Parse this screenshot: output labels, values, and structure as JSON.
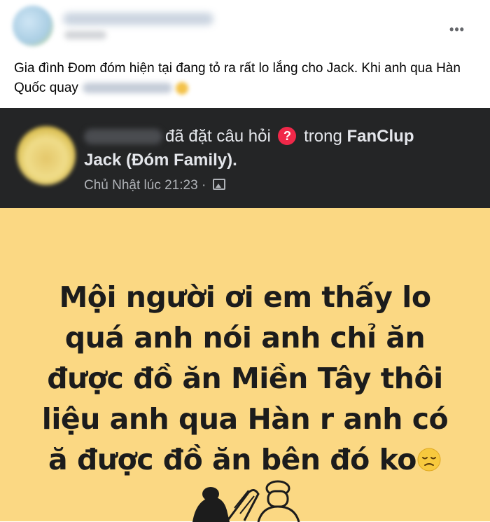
{
  "post": {
    "more_icon": "more-horizontal-icon",
    "text": "Gia đình Đom đóm hiện tại đang tỏ ra rất lo lắng cho Jack. Khi anh qua Hàn Quốc quay"
  },
  "shared": {
    "action_text": "đã đặt câu hỏi",
    "question_icon": "question-mark-icon",
    "in_text": "trong",
    "group_part1": "FanClup",
    "group_part2": "Jack (Đóm Family).",
    "timestamp": "Chủ Nhật lúc 21:23",
    "separator": "·",
    "privacy_icon": "photo-group-icon"
  },
  "image": {
    "lines": [
      "Mội người ơi em thấy lo",
      "quá anh nói anh chỉ ăn",
      "được đồ ăn Miền Tây thôi",
      "liệu anh qua Hàn r anh có",
      "ă được đồ ăn bên đó ko"
    ],
    "emoji": "sad-face-emoji",
    "background_color": "#fbd883"
  },
  "colors": {
    "dark_bar": "#242526",
    "question_red": "#f02849"
  }
}
